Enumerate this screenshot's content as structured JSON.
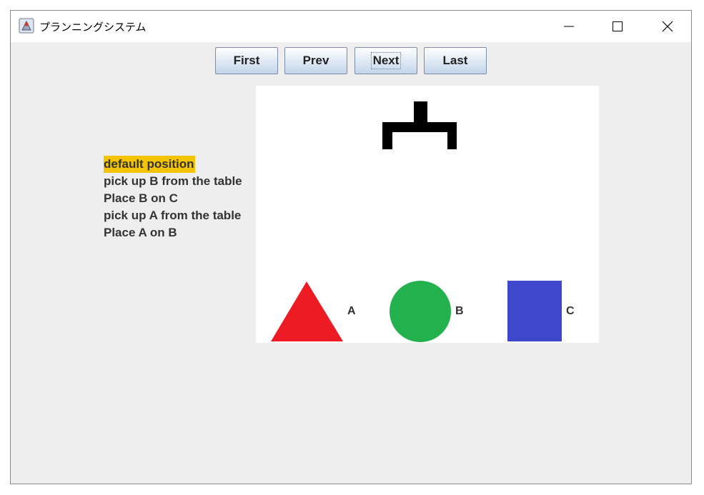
{
  "window": {
    "title": "プランニングシステム"
  },
  "toolbar": {
    "first_label": "First",
    "prev_label": "Prev",
    "next_label": "Next",
    "last_label": "Last"
  },
  "steps": [
    {
      "text": "default position",
      "active": true
    },
    {
      "text": "pick up B from the table",
      "active": false
    },
    {
      "text": "Place B on C",
      "active": false
    },
    {
      "text": "pick up A from the table",
      "active": false
    },
    {
      "text": "Place A on B",
      "active": false
    }
  ],
  "scene": {
    "blocks": [
      {
        "label": "A",
        "shape": "triangle",
        "color": "#ed1c24"
      },
      {
        "label": "B",
        "shape": "circle",
        "color": "#22b14c"
      },
      {
        "label": "C",
        "shape": "square",
        "color": "#3f48cc"
      }
    ],
    "gripper_color": "#000000",
    "highlight_color": "#f5c400"
  }
}
